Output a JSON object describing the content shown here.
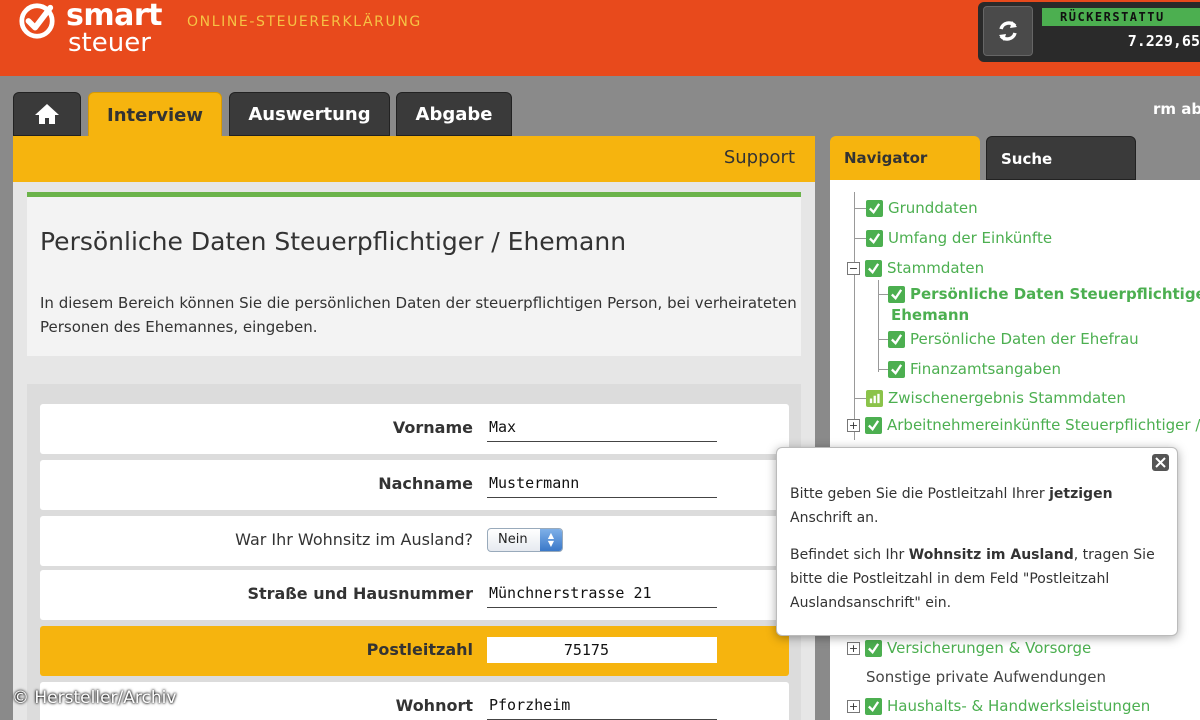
{
  "header": {
    "brand_top": "smart",
    "brand_bottom": "steuer",
    "tagline": "ONLINE-STEUERERKLÄRUNG",
    "refund_label": "RÜCKERSTATTU",
    "refund_value": "7.229,65"
  },
  "tabs": {
    "home_icon": "home-icon",
    "items": [
      "Interview",
      "Auswertung",
      "Abgabe"
    ],
    "active": "Interview"
  },
  "user": {
    "text": "rm ab"
  },
  "content": {
    "support": "Support",
    "title": "Persönliche Daten Steuerpflichtiger / Ehemann",
    "description": "In diesem Bereich können Sie die persönlichen Daten der steuerpflichtigen Person, bei verheirateten Personen des Ehemannes, eingeben.",
    "fields": [
      {
        "label": "Vorname",
        "value": "Max"
      },
      {
        "label": "Nachname",
        "value": "Mustermann"
      },
      {
        "label": "War Ihr Wohnsitz im Ausland?",
        "value": "Nein"
      },
      {
        "label": "Straße und Hausnummer",
        "value": "Münchnerstrasse 21"
      },
      {
        "label": "Postleitzahl",
        "value": "75175"
      },
      {
        "label": "Wohnort",
        "value": "Pforzheim"
      }
    ]
  },
  "navigator": {
    "tabs": [
      "Navigator",
      "Suche"
    ],
    "items": [
      "Grunddaten",
      "Umfang der Einkünfte",
      "Stammdaten",
      "Persönliche Daten Steuerpflichtiger /",
      "Ehemann",
      "Persönliche Daten der Ehefrau",
      "Finanzamtsangaben",
      "Zwischenergebnis Stammdaten",
      "Arbeitnehmereinkünfte Steuerpflichtiger /",
      "Versicherungen & Vorsorge",
      "Sonstige private Aufwendungen",
      "Haushalts- & Handwerksleistungen"
    ]
  },
  "tooltip": {
    "p1_a": "Bitte geben Sie die Postleitzahl Ihrer ",
    "p1_bold": "jetzigen",
    "p1_b": " Anschrift an.",
    "p2_a": "Befindet sich Ihr ",
    "p2_bold": "Wohnsitz im Ausland",
    "p2_b": ", tragen Sie bitte die Postleitzahl in dem Feld \"Postleitzahl Auslandsanschrift\" ein."
  },
  "copyright": "© Hersteller/Archiv",
  "colors": {
    "header": "#e84a1c",
    "accent": "#f6b40e",
    "green": "#4caf50"
  }
}
